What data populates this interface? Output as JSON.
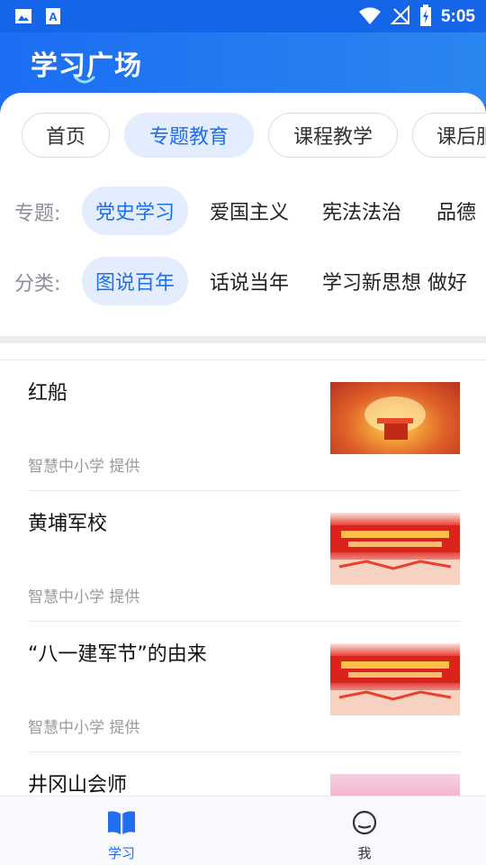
{
  "status_bar": {
    "time": "5:05"
  },
  "header": {
    "title": "学习广场"
  },
  "tabs": [
    {
      "label": "首页",
      "active": false
    },
    {
      "label": "专题教育",
      "active": true
    },
    {
      "label": "课程教学",
      "active": false
    },
    {
      "label": "课后服",
      "active": false
    }
  ],
  "topic_filter": {
    "label": "专题:",
    "options": [
      "党史学习",
      "爱国主义",
      "宪法法治",
      "品德"
    ],
    "selected": "党史学习"
  },
  "category_filter": {
    "label": "分类:",
    "options": [
      "图说百年",
      "话说当年",
      "学习新思想 做好"
    ],
    "selected": "图说百年"
  },
  "items": [
    {
      "title": "红船",
      "source": "智慧中小学 提供",
      "thumb": "sunrise"
    },
    {
      "title": "黄埔军校",
      "source": "智慧中小学 提供",
      "thumb": "red-banner"
    },
    {
      "title": "“八一建军节”的由来",
      "source": "智慧中小学 提供",
      "thumb": "red-banner"
    },
    {
      "title": "井冈山会师",
      "source": "",
      "thumb": "pink"
    }
  ],
  "bottom_nav": [
    {
      "label": "学习",
      "active": true
    },
    {
      "label": "我",
      "active": false
    }
  ],
  "colors": {
    "primary": "#1f6ff0",
    "chip_bg": "#e3edfd"
  }
}
